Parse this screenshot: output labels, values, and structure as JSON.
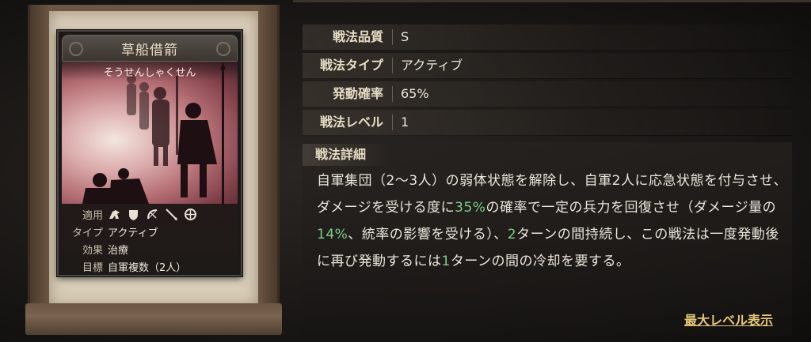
{
  "card": {
    "title": "草船借箭",
    "reading": "そうせんしゃくせん",
    "info": {
      "apply_label": "適用",
      "apply_icons": [
        "cavalry-icon",
        "shield-icon",
        "bow-icon",
        "spear-icon",
        "wheel-icon"
      ],
      "type_label": "タイプ",
      "type_value": "アクティブ",
      "effect_label": "効果",
      "effect_value": "治療",
      "target_label": "目標",
      "target_value": "自軍複数（2人）"
    }
  },
  "stats": [
    {
      "label": "戦法品質",
      "value": "S"
    },
    {
      "label": "戦法タイプ",
      "value": "アクティブ"
    },
    {
      "label": "発動確率",
      "value": "65%"
    },
    {
      "label": "戦法レベル",
      "value": "1"
    }
  ],
  "detail": {
    "title": "戦法詳細",
    "segments": [
      {
        "text": "自軍集団（2〜3人）の弱体状態を解除し、自軍2人に応急状態を付与させ、ダメージを受ける度に",
        "hl": false
      },
      {
        "text": "35%",
        "hl": true
      },
      {
        "text": "の確率で一定の兵力を回復させ（ダメージ量の",
        "hl": false
      },
      {
        "text": "14%",
        "hl": true
      },
      {
        "text": "、統率の影響を受ける）、",
        "hl": false
      },
      {
        "text": "2",
        "hl": true
      },
      {
        "text": "ターンの間持続し、この戦法は一度発動後に再び発動するには",
        "hl": false
      },
      {
        "text": "1",
        "hl": true
      },
      {
        "text": "ターンの間の冷却を要する。",
        "hl": false
      }
    ]
  },
  "max_level_link": "最大レベル表示",
  "colors": {
    "highlight": "#7ccf8a",
    "link": "#e6c877",
    "label": "#e6dcc4"
  }
}
